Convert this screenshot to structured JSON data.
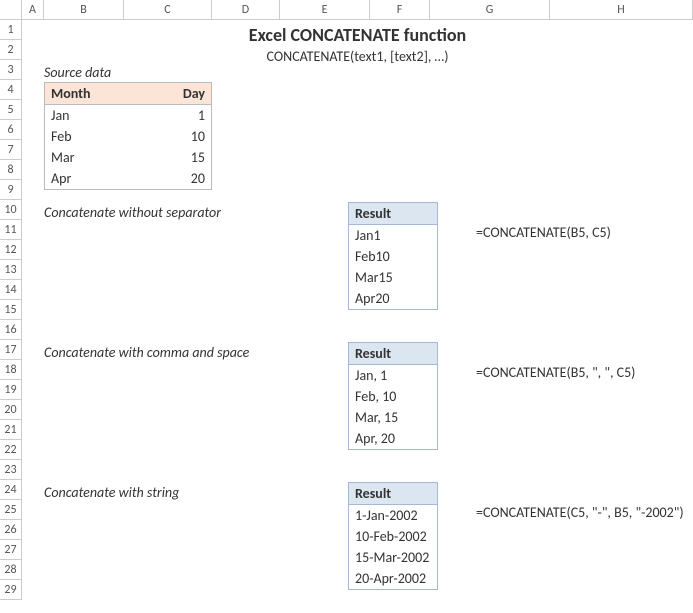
{
  "columns": [
    "A",
    "B",
    "C",
    "D",
    "E",
    "F",
    "G",
    "H"
  ],
  "rowCount": 29,
  "title": "Excel CONCATENATE function",
  "subtitle": "CONCATENATE(text1, [text2], …)",
  "sourceLabel": "Source data",
  "sourceHeaders": {
    "month": "Month",
    "day": "Day"
  },
  "sourceData": [
    {
      "month": "Jan",
      "day": "1"
    },
    {
      "month": "Feb",
      "day": "10"
    },
    {
      "month": "Mar",
      "day": "15"
    },
    {
      "month": "Apr",
      "day": "20"
    }
  ],
  "examples": [
    {
      "label": "Concatenate without separator",
      "resultHeader": "Result",
      "results": [
        "Jan1",
        "Feb10",
        "Mar15",
        "Apr20"
      ],
      "formula": "=CONCATENATE(B5, C5)",
      "labelTop": 184,
      "tableTop": 182,
      "formulaTop": 204
    },
    {
      "label": "Concatenate with comma and space",
      "resultHeader": "Result",
      "results": [
        "Jan, 1",
        "Feb, 10",
        "Mar, 15",
        "Apr, 20"
      ],
      "formula": "=CONCATENATE(B5, \", \",  C5)",
      "labelTop": 324,
      "tableTop": 322,
      "formulaTop": 344
    },
    {
      "label": "Concatenate with string",
      "resultHeader": "Result",
      "results": [
        "1-Jan-2002",
        "10-Feb-2002",
        "15-Mar-2002",
        "20-Apr-2002"
      ],
      "formula": "=CONCATENATE(C5, \"-\", B5, \"-2002\")",
      "labelTop": 464,
      "tableTop": 462,
      "formulaTop": 484
    }
  ]
}
